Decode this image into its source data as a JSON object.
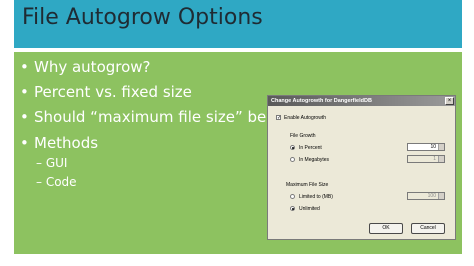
{
  "slide": {
    "title": "File Autogrow Options",
    "bullets": [
      {
        "marker": "•",
        "text": "Why autogrow?"
      },
      {
        "marker": "•",
        "text": "Percent vs. fixed size"
      },
      {
        "marker": "•",
        "text": "Should “maximum file size” be set?"
      },
      {
        "marker": "•",
        "text": "Methods"
      }
    ],
    "subbullets": [
      {
        "text": "– GUI"
      },
      {
        "text": "– Code"
      }
    ]
  },
  "dialog": {
    "title": "Change Autogrowth for DangerfieldDB",
    "close": "×",
    "enable_autogrowth": {
      "label": "Enable Autogrowth",
      "checked": true,
      "mark": "✓"
    },
    "file_growth": {
      "heading": "File Growth",
      "in_percent": {
        "label": "In Percent",
        "selected": true,
        "value": "10"
      },
      "in_megabytes": {
        "label": "In Megabytes",
        "selected": false,
        "value": "1"
      }
    },
    "max_file_size": {
      "heading": "Maximum File Size",
      "limited": {
        "label": "Limited to (MB)",
        "selected": false,
        "value": "100"
      },
      "unlimited": {
        "label": "Unlimited",
        "selected": true
      }
    },
    "ok_label": "OK",
    "cancel_label": "Cancel"
  },
  "colors": {
    "title_bar": "#2fa8c4",
    "content_bg": "#8dc260",
    "text_white": "#ffffff"
  }
}
